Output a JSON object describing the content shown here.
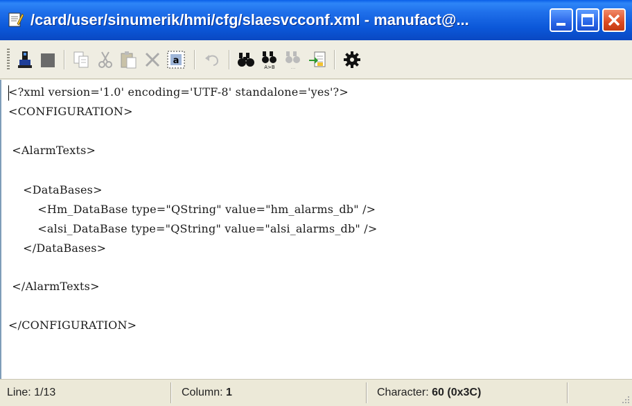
{
  "window": {
    "title": "/card/user/sinumerik/hmi/cfg/slaesvcconf.xml - manufact@..."
  },
  "toolbar": {
    "buttons": [
      {
        "name": "save-file-icon"
      },
      {
        "name": "stop-icon"
      },
      {
        "name": "copy-icon"
      },
      {
        "name": "cut-icon"
      },
      {
        "name": "paste-icon"
      },
      {
        "name": "delete-icon"
      },
      {
        "name": "select-all-icon"
      },
      {
        "name": "undo-icon"
      },
      {
        "name": "find-icon"
      },
      {
        "name": "find-replace-icon"
      },
      {
        "name": "find-next-icon"
      },
      {
        "name": "goto-icon"
      },
      {
        "name": "settings-icon"
      }
    ]
  },
  "editor": {
    "lines": [
      "<?xml version='1.0' encoding='UTF-8' standalone='yes'?>",
      "<CONFIGURATION>",
      "",
      " <AlarmTexts>",
      "",
      "",
      "    <DataBases>",
      "        <Hm_DataBase type=\"QString\" value=\"hm_alarms_db\" />",
      "        <alsi_DataBase type=\"QString\" value=\"alsi_alarms_db\" />",
      "    </DataBases>",
      "",
      " </AlarmTexts>",
      "",
      "</CONFIGURATION>"
    ]
  },
  "status": {
    "line_label": "Line:",
    "line_value": "1/13",
    "column_label": "Column:",
    "column_value": "1",
    "character_label": "Character:",
    "character_value": "60 (0x3C)"
  },
  "colors": {
    "titlebar": "#0B57D8",
    "close_button": "#DC4B22",
    "editor_bg": "#FFFFFF",
    "chrome": "#ECE9D8"
  }
}
